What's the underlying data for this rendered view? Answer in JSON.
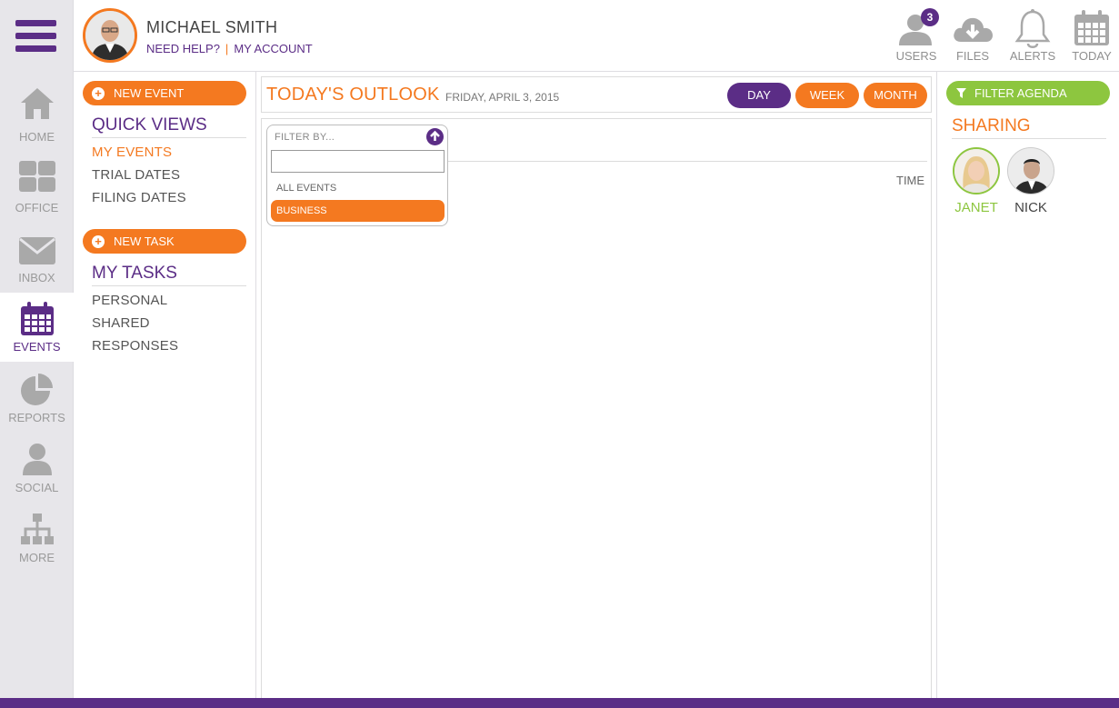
{
  "colors": {
    "purple": "#5b2d86",
    "orange": "#f47920",
    "green": "#8dc63f",
    "gray": "#9a9a9a"
  },
  "rail": {
    "menu_icon": "hamburger-icon",
    "items": [
      {
        "label": "HOME",
        "icon": "home-icon"
      },
      {
        "label": "OFFICE",
        "icon": "grid-icon"
      },
      {
        "label": "INBOX",
        "icon": "envelope-icon"
      },
      {
        "label": "EVENTS",
        "icon": "calendar-icon",
        "active": true
      },
      {
        "label": "REPORTS",
        "icon": "pie-chart-icon"
      },
      {
        "label": "SOCIAL",
        "icon": "person-icon"
      },
      {
        "label": "MORE",
        "icon": "sitemap-icon"
      }
    ]
  },
  "header": {
    "user_name": "MICHAEL SMITH",
    "help_link": "NEED HELP?",
    "account_link": "MY ACCOUNT",
    "icons": [
      {
        "label": "USERS",
        "icon": "users-icon",
        "badge": "3"
      },
      {
        "label": "FILES",
        "icon": "cloud-download-icon"
      },
      {
        "label": "ALERTS",
        "icon": "bell-icon"
      },
      {
        "label": "TODAY",
        "icon": "calendar-icon"
      }
    ]
  },
  "left": {
    "new_event": "NEW EVENT",
    "quick_views_title": "QUICK VIEWS",
    "quick_views": [
      "MY EVENTS",
      "TRIAL DATES",
      "FILING DATES"
    ],
    "new_task": "NEW TASK",
    "my_tasks_title": "MY TASKS",
    "tasks": [
      "PERSONAL",
      "SHARED",
      "RESPONSES"
    ]
  },
  "main": {
    "title": "TODAY'S OUTLOOK",
    "date": "FRIDAY, APRIL 3, 2015",
    "views": [
      "DAY",
      "WEEK",
      "MONTH"
    ],
    "active_view": "DAY",
    "time_label": "TIME",
    "filter": {
      "title": "FILTER BY...",
      "input_value": "",
      "options": [
        "ALL EVENTS",
        "BUSINESS"
      ],
      "selected": "BUSINESS"
    }
  },
  "right": {
    "filter_agenda": "FILTER AGENDA",
    "sharing_title": "SHARING",
    "people": [
      {
        "name": "JANET",
        "active": true
      },
      {
        "name": "NICK",
        "active": false
      }
    ]
  }
}
